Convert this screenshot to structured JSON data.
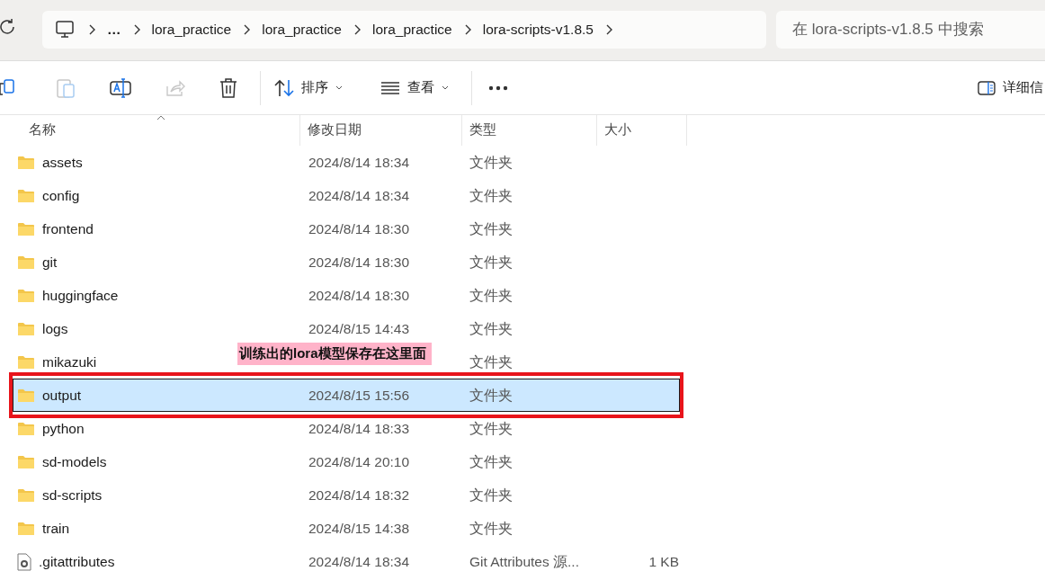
{
  "address_bar": {
    "crumbs": [
      "…",
      "lora_practice",
      "lora_practice",
      "lora_practice",
      "lora-scripts-v1.8.5"
    ]
  },
  "search": {
    "placeholder": "在 lora-scripts-v1.8.5 中搜索"
  },
  "toolbar": [
    {
      "kind": "copy",
      "disabled": false
    },
    {
      "kind": "paste",
      "disabled": true
    },
    {
      "kind": "rename",
      "disabled": false
    },
    {
      "kind": "share",
      "disabled": true
    },
    {
      "kind": "delete",
      "disabled": false
    },
    {
      "kind": "sort",
      "label": "排序",
      "disabled": false
    },
    {
      "kind": "view",
      "label": "查看",
      "disabled": false
    },
    {
      "kind": "more",
      "disabled": false
    }
  ],
  "details_button": {
    "label": "详细信"
  },
  "columns": [
    "名称",
    "修改日期",
    "类型",
    "大小"
  ],
  "rows": [
    {
      "kind": "folder",
      "name": "assets",
      "date": "2024/8/14 18:34",
      "type": "文件夹",
      "selected": false
    },
    {
      "kind": "folder",
      "name": "config",
      "date": "2024/8/14 18:34",
      "type": "文件夹",
      "selected": false
    },
    {
      "kind": "folder",
      "name": "frontend",
      "date": "2024/8/14 18:30",
      "type": "文件夹",
      "selected": false
    },
    {
      "kind": "folder",
      "name": "git",
      "date": "2024/8/14 18:30",
      "type": "文件夹",
      "selected": false
    },
    {
      "kind": "folder",
      "name": "huggingface",
      "date": "2024/8/14 18:30",
      "type": "文件夹",
      "selected": false
    },
    {
      "kind": "folder",
      "name": "logs",
      "date": "2024/8/15 14:43",
      "type": "文件夹",
      "selected": false
    },
    {
      "kind": "folder",
      "name": "mikazuki",
      "type": "文件夹",
      "selected": false
    },
    {
      "kind": "folder",
      "name": "output",
      "date": "2024/8/15 15:56",
      "type": "文件夹",
      "selected": true,
      "annotation": "训练出的lora模型保存在这里面"
    },
    {
      "kind": "folder",
      "name": "python",
      "date": "2024/8/14 18:33",
      "type": "文件夹",
      "selected": false
    },
    {
      "kind": "folder",
      "name": "sd-models",
      "date": "2024/8/14 20:10",
      "type": "文件夹",
      "selected": false
    },
    {
      "kind": "folder",
      "name": "sd-scripts",
      "date": "2024/8/14 18:32",
      "type": "文件夹",
      "selected": false
    },
    {
      "kind": "folder",
      "name": "train",
      "date": "2024/8/15 14:38",
      "type": "文件夹",
      "selected": false
    },
    {
      "kind": "file",
      "name": ".gitattributes",
      "date": "2024/8/14 18:34",
      "type": "Git Attributes 源...",
      "size": "1 KB",
      "selected": false
    }
  ]
}
